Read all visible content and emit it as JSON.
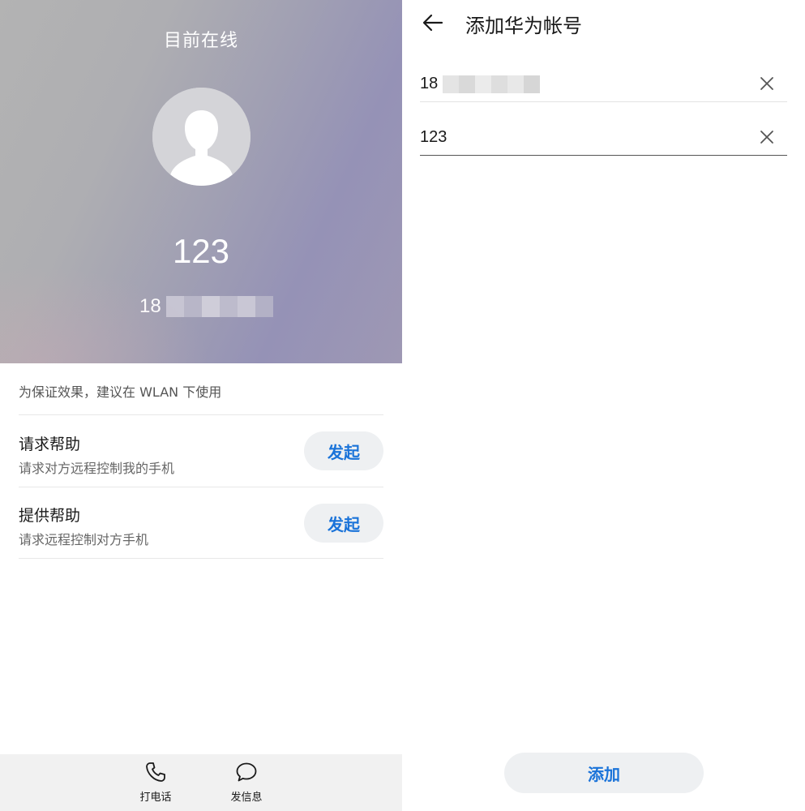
{
  "left_panel": {
    "status_text": "目前在线",
    "contact": {
      "name": "123",
      "phone_visible": "18"
    },
    "wlan_tip": "为保证效果，建议在 WLAN 下使用",
    "options": [
      {
        "title": "请求帮助",
        "subtitle": "请求对方远程控制我的手机",
        "button": "发起"
      },
      {
        "title": "提供帮助",
        "subtitle": "请求远程控制对方手机",
        "button": "发起"
      }
    ],
    "bottom_bar": [
      {
        "label": "打电话",
        "icon": "phone-icon"
      },
      {
        "label": "发信息",
        "icon": "message-icon"
      }
    ]
  },
  "right_panel": {
    "title": "添加华为帐号",
    "fields": [
      {
        "value": "18",
        "clear_icon": "close-icon"
      },
      {
        "value": "123",
        "clear_icon": "close-icon"
      }
    ],
    "add_button": "添加"
  },
  "colors": {
    "accent": "#1a73d9",
    "button_bg": "#eef0f2",
    "bottom_bar_bg": "#f1f1f1"
  }
}
